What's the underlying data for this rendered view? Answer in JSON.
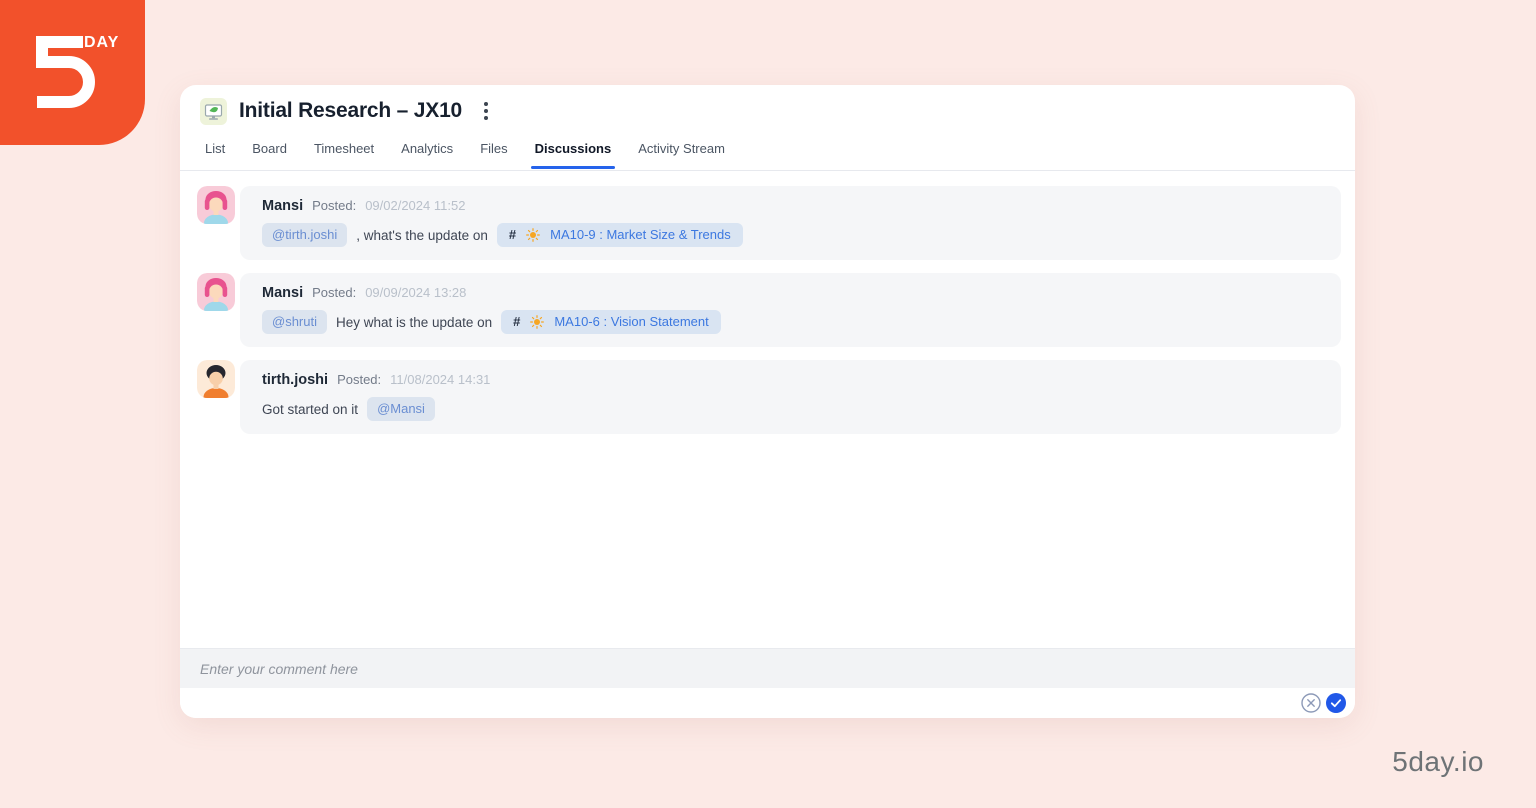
{
  "logo": {
    "digit": "5",
    "text": "DAY"
  },
  "watermark": "5day.io",
  "header": {
    "title": "Initial Research – JX10"
  },
  "tabs": [
    {
      "label": "List"
    },
    {
      "label": "Board"
    },
    {
      "label": "Timesheet"
    },
    {
      "label": "Analytics"
    },
    {
      "label": "Files"
    },
    {
      "label": "Discussions"
    },
    {
      "label": "Activity Stream"
    }
  ],
  "active_tab": "Discussions",
  "messages": [
    {
      "author": "Mansi",
      "posted_label": "Posted:",
      "timestamp": "09/02/2024 11:52",
      "mention": "@tirth.joshi",
      "text": ", what's the update on",
      "task_hash": "#",
      "task_title": "MA10-9 : Market Size & Trends"
    },
    {
      "author": "Mansi",
      "posted_label": "Posted:",
      "timestamp": "09/09/2024 13:28",
      "mention": "@shruti",
      "text": "Hey what is the update on",
      "task_hash": "#",
      "task_title": "MA10-6 : Vision Statement"
    },
    {
      "author": "tirth.joshi",
      "posted_label": "Posted:",
      "timestamp": "11/08/2024 14:31",
      "text": "Got started on it",
      "mention_after": "@Mansi"
    }
  ],
  "composer": {
    "placeholder": "Enter your comment here"
  },
  "colors": {
    "accent_blue": "#2563eb",
    "brand_orange": "#f2512b",
    "mention_text": "#6a8ed2",
    "task_link_text": "#3c78e0",
    "page_background": "#fceae6"
  }
}
